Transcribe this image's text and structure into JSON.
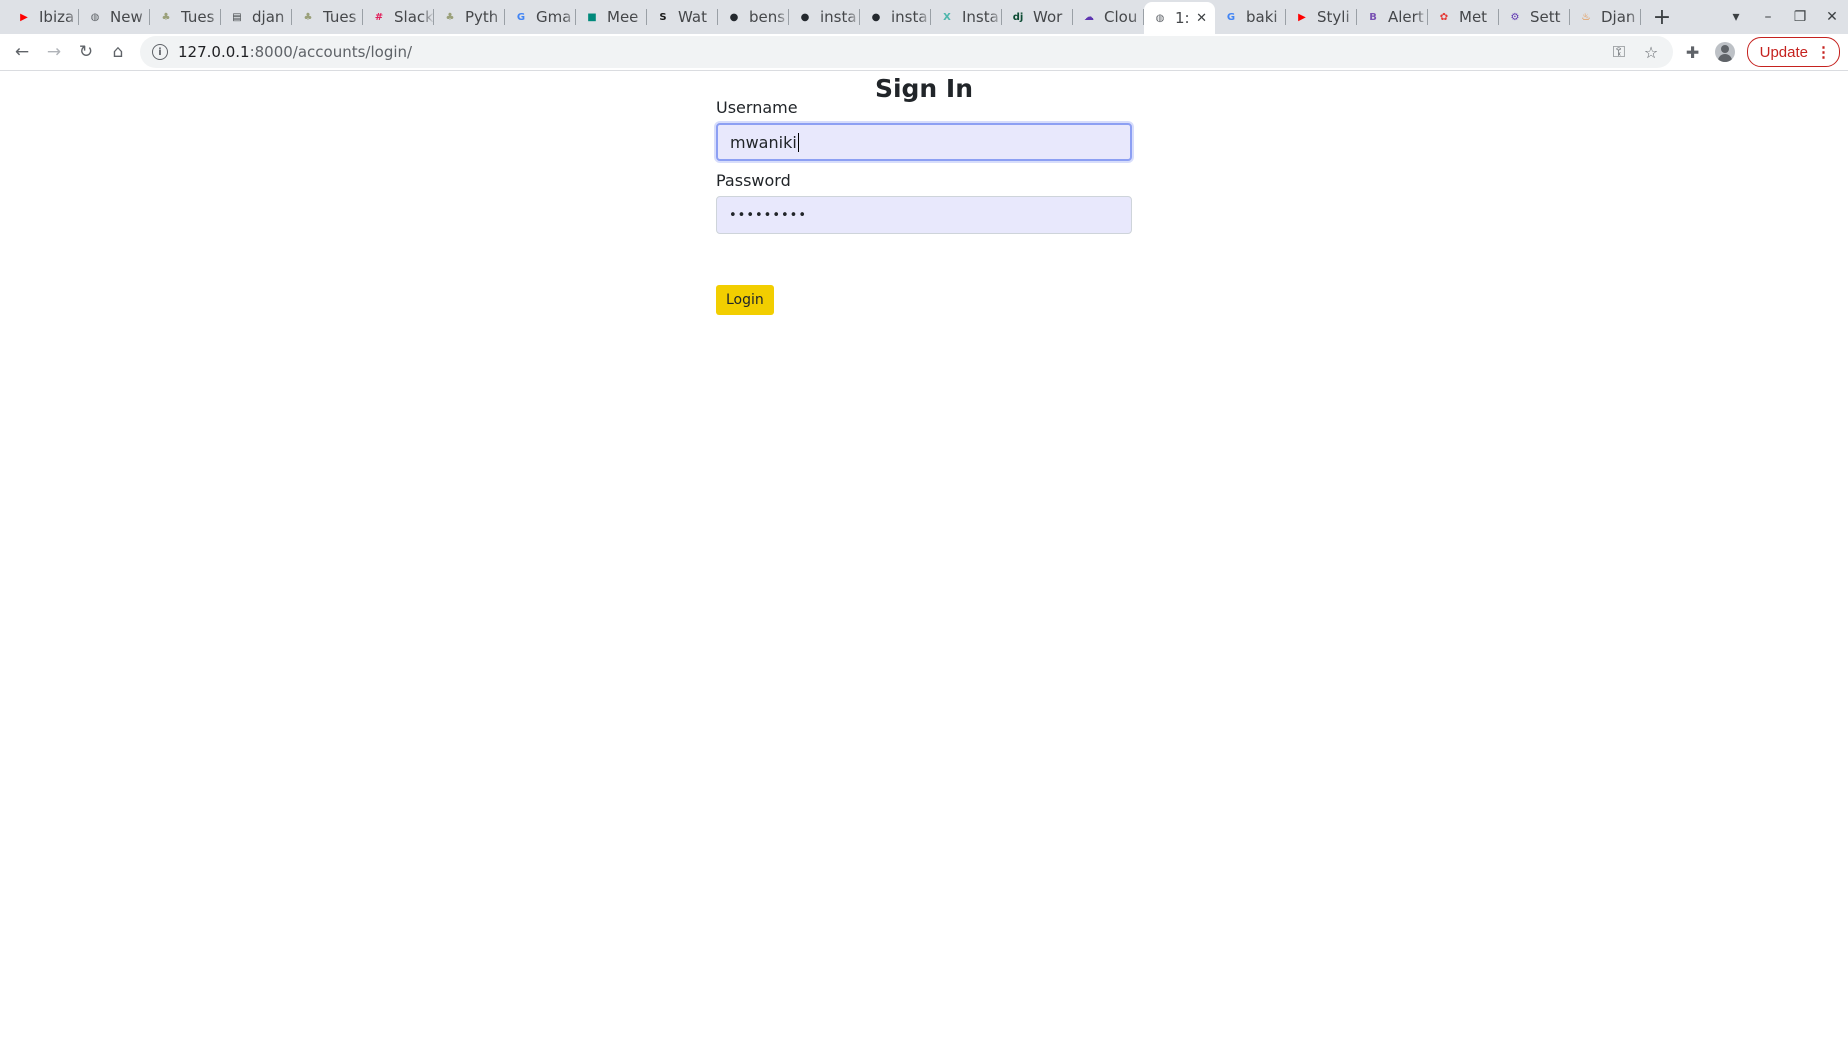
{
  "browser": {
    "tabs": [
      {
        "title": "Ibiza",
        "icon": "youtube-icon",
        "color": "#ff0000",
        "glyph": "▶"
      },
      {
        "title": "New",
        "icon": "globe-icon",
        "color": "#5f6368",
        "glyph": "◍"
      },
      {
        "title": "Tues",
        "icon": "tree-icon",
        "color": "#9aa07a",
        "glyph": "♣"
      },
      {
        "title": "djan",
        "icon": "document-icon",
        "color": "#3c4043",
        "glyph": "▤"
      },
      {
        "title": "Tues",
        "icon": "tree-icon",
        "color": "#9aa07a",
        "glyph": "♣"
      },
      {
        "title": "Slack",
        "icon": "slack-icon",
        "color": "#e01e5a",
        "glyph": "#"
      },
      {
        "title": "Pyth",
        "icon": "tree-icon",
        "color": "#9aa07a",
        "glyph": "♣"
      },
      {
        "title": "Gma",
        "icon": "google-icon",
        "color": "#4285f4",
        "glyph": "G"
      },
      {
        "title": "Mee",
        "icon": "meet-icon",
        "color": "#00897b",
        "glyph": "■"
      },
      {
        "title": "Wat",
        "icon": "s-icon",
        "color": "#1a1a1a",
        "glyph": "S"
      },
      {
        "title": "bens",
        "icon": "github-icon",
        "color": "#24292e",
        "glyph": "●"
      },
      {
        "title": "insta",
        "icon": "github-icon",
        "color": "#24292e",
        "glyph": "●"
      },
      {
        "title": "insta",
        "icon": "github-icon",
        "color": "#24292e",
        "glyph": "●"
      },
      {
        "title": "Insta",
        "icon": "x-icon",
        "color": "#4db6ac",
        "glyph": "X"
      },
      {
        "title": "Wor",
        "icon": "dj-icon",
        "color": "#0c4b33",
        "glyph": "dj"
      },
      {
        "title": "Clou",
        "icon": "cloud-icon",
        "color": "#5e35b1",
        "glyph": "☁"
      },
      {
        "title": "1:",
        "icon": "globe-icon",
        "color": "#5f6368",
        "glyph": "◍",
        "active": true,
        "close": "✕"
      },
      {
        "title": "baki",
        "icon": "google-icon",
        "color": "#4285f4",
        "glyph": "G"
      },
      {
        "title": "Styli",
        "icon": "youtube-icon",
        "color": "#ff0000",
        "glyph": "▶"
      },
      {
        "title": "Alert",
        "icon": "bootstrap-icon",
        "color": "#7952b3",
        "glyph": "B"
      },
      {
        "title": "Met",
        "icon": "meta-icon",
        "color": "#e53935",
        "glyph": "✿"
      },
      {
        "title": "Sett",
        "icon": "gear-icon",
        "color": "#5e35b1",
        "glyph": "⚙"
      },
      {
        "title": "Djan",
        "icon": "java-icon",
        "color": "#e76f00",
        "glyph": "♨"
      }
    ],
    "new_tab": "+",
    "window_controls": {
      "menu": "▾",
      "minimize": "–",
      "restore": "❐",
      "close": "✕"
    },
    "nav": {
      "back": "←",
      "forward": "→",
      "reload": "↻",
      "home": "⌂"
    },
    "address": {
      "info": "i",
      "host": "127.0.0.1",
      "path": ":8000/accounts/login/"
    },
    "omnibox_icons": {
      "key": "⚿",
      "star": "☆"
    },
    "extensions": "✚",
    "update_label": "Update",
    "more_menu": "⋮"
  },
  "page": {
    "heading": "Sign In",
    "username_label": "Username",
    "username_value": "mwaniki",
    "password_label": "Password",
    "password_value": "•••••••••",
    "login_label": "Login"
  },
  "colors": {
    "login_button": "#f2ce00",
    "input_autofill": "#e8e8fc",
    "focus_ring": "#8c9ff3"
  }
}
